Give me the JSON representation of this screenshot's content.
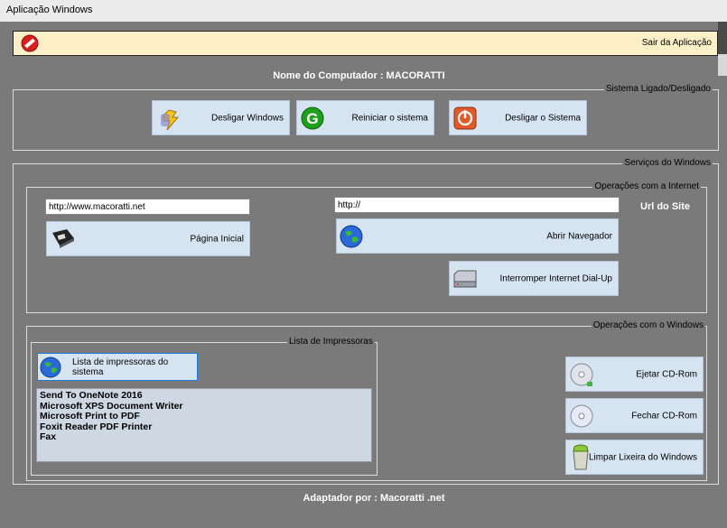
{
  "window": {
    "title": "Aplicação Windows"
  },
  "exit": {
    "label": "Sair da Aplicação",
    "icon": "no-entry-icon"
  },
  "computer_name": "Nome do Computador : MACORATTI",
  "power_group": {
    "title": "Sistema Ligado/Desligado",
    "buttons": [
      {
        "label": "Desligar Windows",
        "icon": "power-lightning-icon"
      },
      {
        "label": "Reiniciar o sistema",
        "icon": "green-g-icon"
      },
      {
        "label": "Desligar o Sistema",
        "icon": "power-off-icon"
      }
    ]
  },
  "services_group": {
    "title": "Serviços do Windows",
    "internet": {
      "title": "Operações com a Internet",
      "home_url": "http://www.macoratti.net",
      "browse_url": "http://",
      "url_label": "Url do Site",
      "home_button": "Página Inicial",
      "browser_button": "Abrir Navegador",
      "dialup_button": "Interromper Internet Dial-Up"
    },
    "windows_ops": {
      "title": "Operações com o Windows",
      "printers": {
        "title": "Lista de Impressoras",
        "button": "Lista de impressoras do sistema",
        "items": [
          "Send To OneNote 2016",
          "Microsoft XPS Document Writer",
          "Microsoft Print to PDF",
          "Foxit Reader PDF Printer",
          "Fax"
        ]
      },
      "eject_button": "Ejetar CD-Rom",
      "close_button": "Fechar CD-Rom",
      "trash_button": "Limpar Lixeira do Windows"
    }
  },
  "footer": "Adaptador por : Macoratti .net",
  "colors": {
    "background": "#7a7a7a",
    "button": "#d6e4f2",
    "exit_bar": "#fdf0c8",
    "list": "#cdd8e3"
  }
}
